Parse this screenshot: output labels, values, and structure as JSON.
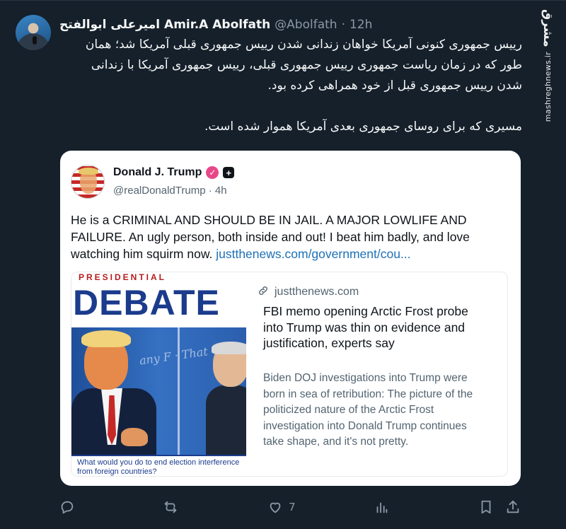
{
  "tweet": {
    "author_name": "Amir.A Abolfath",
    "author_name_fa": "امیرعلی ابوالفتح",
    "handle": "@Abolfath",
    "separator": "·",
    "time": "12h",
    "more_icon": "more-icon",
    "text_p1": "رییس جمهوری کنونی آمریکا خواهان زندانی شدن رییس جمهوری قبلی آمریکا شد؛ همان طور که در زمان ریاست جمهوری رییس جمهوری قبلی، رییس جمهوری آمریکا با زندانی شدن رییس جمهوری قبل از خود همراهی کرده بود.",
    "text_p2": "مسیری که برای روسای جمهوری بعدی آمریکا هموار شده است."
  },
  "watermark": {
    "logo": "مشرق",
    "url": "mashreghnews.ir"
  },
  "quoted": {
    "author_name": "Donald J. Trump",
    "handle": "@realDonaldTrump",
    "separator": "·",
    "time": "4h",
    "plus_badge": "+",
    "text": "He is a CRIMINAL AND SHOULD BE IN JAIL. A MAJOR LOWLIFE AND FAILURE. An ugly person, both inside and out! I beat him badly, and love watching him squirm now. ",
    "link_text": "justthenews.com/government/cou..."
  },
  "link_card": {
    "image_banner_top": "PRESIDENTIAL",
    "image_banner_word": "DEBATE",
    "image_script": "any F · That · People · the R",
    "image_chyron": "What would you do to end election interference from foreign countries?",
    "domain": "justthenews.com",
    "title": "FBI memo opening Arctic Frost probe into Trump was thin on evidence and justification, experts say",
    "description": "Biden DOJ investigations into Trump were born in sea of retribution: The picture of the politicized nature of the Arctic Frost investigation into Donald Trump continues take shape, and it's not pretty."
  },
  "actions": {
    "reply_icon": "reply-icon",
    "retweet_icon": "retweet-icon",
    "like_icon": "heart-icon",
    "like_count": "7",
    "views_icon": "views-icon",
    "bookmark_icon": "bookmark-icon",
    "share_icon": "share-icon"
  },
  "colors": {
    "background": "#15202b",
    "text": "#f7f9f9",
    "muted": "#8b98a5",
    "link": "#1d70b8",
    "verified_badge": "#e8488a"
  }
}
